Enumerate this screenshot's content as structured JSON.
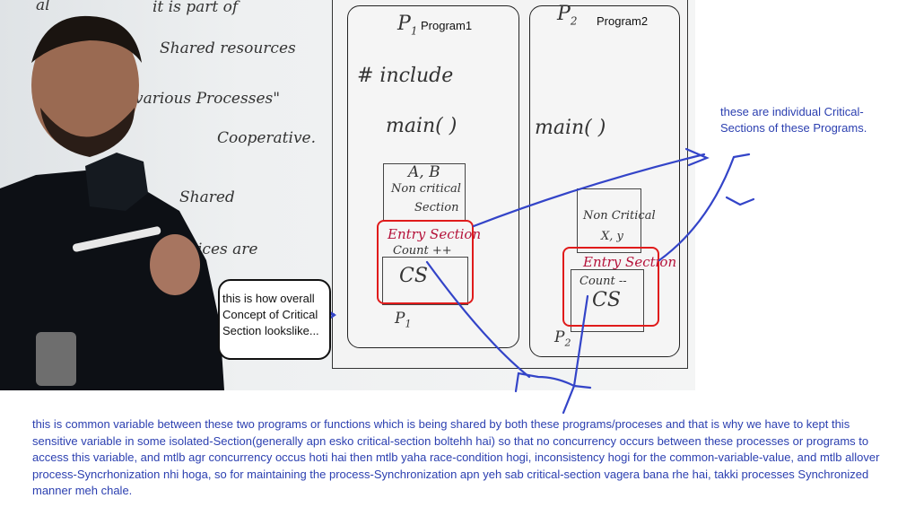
{
  "board": {
    "program1": {
      "title": "Program1",
      "p_label": "P",
      "p_sub": "1"
    },
    "program2": {
      "title": "Program2",
      "p_label": "P",
      "p_sub": "2"
    },
    "left_board_text": [
      "al",
      "it is part of",
      "Shared resources",
      "various Processes\"",
      "Cooperative.",
      "Shared",
      "ices are"
    ],
    "p1_code": {
      "include": "# include",
      "main": "main( )",
      "vars": "A, B",
      "noncrit": "Non critical",
      "section": "Section",
      "entry": "Entry Section",
      "count": "Count ++",
      "cs": "CS",
      "proc": "P",
      "proc_sub": "1"
    },
    "p2_code": {
      "main": "main( )",
      "noncrit": "Non Critical",
      "vars": "X, y",
      "entry": "Entry Section",
      "count": "Count --",
      "cs": "CS",
      "proc": "P",
      "proc_sub": "2"
    }
  },
  "annotations": {
    "callout": "this is how overall Concept of Critical Section lookslike...",
    "right_note": "these are individual Critical-Sections of these Programs.",
    "bottom_note": "this is common variable between these two programs or functions which is being shared by both these programs/proceses and that is why we have to kept this sensitive variable in some isolated-Section(generally apn esko critical-section boltehh hai) so that no concurrency occurs between these processes or programs to access this variable, and mtlb agr concurrency occus hoti hai then mtlb yaha race-condition hogi, inconsistency hogi for the common-variable-value, and mtlb allover process-Syncrhonization nhi hoga, so for maintaining the process-Synchronization apn yeh sab critical-section vagera bana rhe hai, takki processes Synchronized manner meh chale."
  },
  "colors": {
    "annotation_blue": "#2b3fb0",
    "highlight_red": "#e01b1b",
    "entry_red": "#b5123a"
  }
}
